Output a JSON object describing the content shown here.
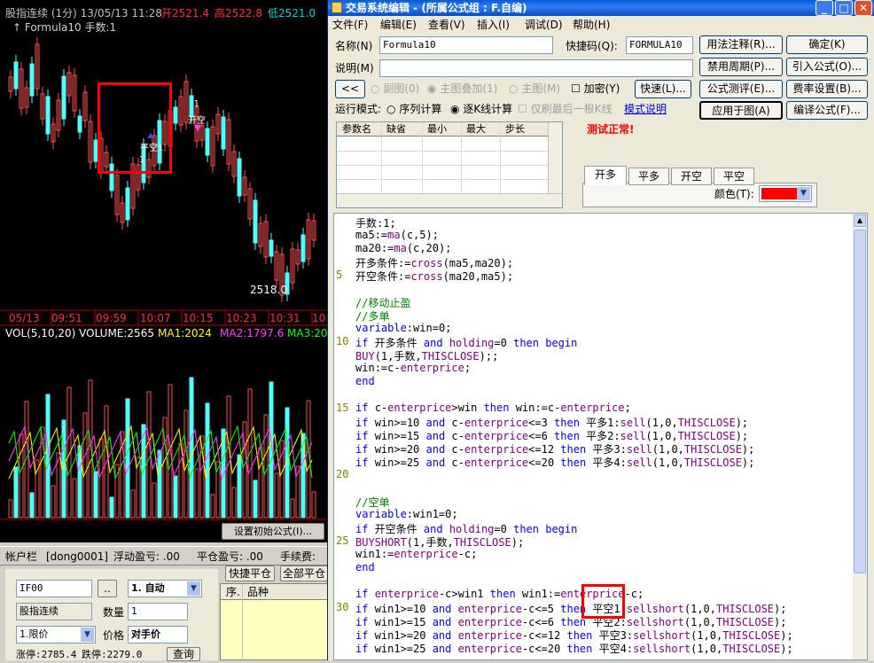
{
  "chart": {
    "header": "股指连续 (1分) 13/05/13 11:28",
    "open": "开2521.4",
    "high": "高2522.8",
    "low": "低2521.0",
    "formula": "↑ Formula10  手数:1",
    "label_close_short": "平空1",
    "label_one": "1",
    "label_neg1": "-1",
    "label_open_short": "开空",
    "low_price": "2518.0",
    "times": [
      "05/13",
      "09:51",
      "09:59",
      "10:07",
      "10:15",
      "10:23",
      "10:31",
      "10:39"
    ],
    "vol_title": "VOL(5,10,20)",
    "vol_value": "VOLUME:2565",
    "ma1": "MA1:2024",
    "ma2": "MA2:1797.6",
    "ma3": "MA3:20",
    "set_initial_btn": "设置初始公式(I)..."
  },
  "trade": {
    "account_label": "帐户栏",
    "account_id": "[dong0001]",
    "float_pl": "浮动盈亏: .00",
    "close_pl": "平仓盈亏: .00",
    "fee": "手续费:",
    "contract_code": "IF00",
    "browse": "..",
    "mode_select": "1. 自动",
    "fast_close": "快捷平仓",
    "close_all": "全部平仓",
    "contract_name": "股指连续",
    "qty_label": "数量",
    "qty_value": "1",
    "price_type": "1.限价",
    "price_label": "价格",
    "price_value": "对手价",
    "limit_up": "涨停:2785.4",
    "limit_down": "跌停:2279.0",
    "query_btn": "查询",
    "col_seq": "序.",
    "col_product": "品种"
  },
  "dialog": {
    "title": "交易系统编辑 - (所属公式组 : F.自编)",
    "menu": [
      "文件(F)",
      "编辑(E)",
      "查看(V)",
      "插入(I)",
      "调试(D)",
      "帮助(H)"
    ],
    "name_label": "名称(N)",
    "name_value": "Formula10",
    "shortcut_label": "快捷码(Q):",
    "shortcut_value": "FORMULA10",
    "desc_label": "说明(M)",
    "btn_usage": "用法注释(R)...",
    "btn_ok": "确定(K)",
    "btn_forbid": "禁用周期(P)...",
    "btn_import": "引入公式(O)...",
    "btn_test": "公式测评(E)...",
    "btn_fee": "费率设置(B)...",
    "btn_apply": "应用于图(A)",
    "btn_compile": "编译公式(F)...",
    "btn_back": "<<",
    "radio_sub": "副图(0)",
    "radio_overlay": "主图叠加(1)",
    "radio_main": "主图(M)",
    "chk_encrypt": "加密(Y)",
    "btn_quick": "快速(L)...",
    "run_mode_label": "运行模式:",
    "radio_seq": "序列计算",
    "radio_kline": "逐K线计算",
    "chk_last": "仅刷最后一根K线",
    "mode_help": "模式说明",
    "param_headers": [
      "参数名",
      "缺省",
      "最小",
      "最大",
      "步长"
    ],
    "status": "测试正常!",
    "tabs": [
      "开多",
      "平多",
      "开空",
      "平空"
    ],
    "color_label": "颜色(T):",
    "color_value": "#ff0000"
  },
  "code_lines": [
    {
      "n": "",
      "t": "手数:1;"
    },
    {
      "n": "",
      "t": "ma5:=ma(c,5);"
    },
    {
      "n": "",
      "t": "ma20:=ma(c,20);"
    },
    {
      "n": "",
      "t": "开多条件:=cross(ma5,ma20);"
    },
    {
      "n": "5",
      "t": "开空条件:=cross(ma20,ma5);"
    },
    {
      "n": "",
      "t": ""
    },
    {
      "n": "",
      "t": "//移动止盈"
    },
    {
      "n": "",
      "t": "//多单"
    },
    {
      "n": "",
      "t": "variable:win=0;"
    },
    {
      "n": "10",
      "t": "if 开多条件 and holding=0 then begin"
    },
    {
      "n": "",
      "t": "BUY(1,手数,THISCLOSE);;"
    },
    {
      "n": "",
      "t": "win:=c-enterprice;"
    },
    {
      "n": "",
      "t": "end"
    },
    {
      "n": "",
      "t": ""
    },
    {
      "n": "15",
      "t": "if c-enterprice>win then win:=c-enterprice;"
    },
    {
      "n": "",
      "t": "if win>=10 and c-enterprice<=3 then 平多1:sell(1,0,THISCLOSE);"
    },
    {
      "n": "",
      "t": "if win>=15 and c-enterprice<=6 then 平多2:sell(1,0,THISCLOSE);"
    },
    {
      "n": "",
      "t": "if win>=20 and c-enterprice<=12 then 平多3:sell(1,0,THISCLOSE);"
    },
    {
      "n": "",
      "t": "if win>=25 and c-enterprice<=20 then 平多4:sell(1,0,THISCLOSE);"
    },
    {
      "n": "20",
      "t": ""
    },
    {
      "n": "",
      "t": ""
    },
    {
      "n": "",
      "t": "//空单"
    },
    {
      "n": "",
      "t": "variable:win1=0;"
    },
    {
      "n": "",
      "t": "if 开空条件 and holding=0 then begin"
    },
    {
      "n": "25",
      "t": "BUYSHORT(1,手数,THISCLOSE);"
    },
    {
      "n": "",
      "t": "win1:=enterprice-c;"
    },
    {
      "n": "",
      "t": "end"
    },
    {
      "n": "",
      "t": ""
    },
    {
      "n": "",
      "t": "if enterprice-c>win1 then win1:=enterprice-c;"
    },
    {
      "n": "30",
      "t": "if win1>=10 and enterprice-c<=5 then 平空1:sellshort(1,0,THISCLOSE);"
    },
    {
      "n": "",
      "t": "if win1>=15 and enterprice-c<=6 then 平空2:sellshort(1,0,THISCLOSE);"
    },
    {
      "n": "",
      "t": "if win1>=20 and enterprice-c<=12 then 平空3:sellshort(1,0,THISCLOSE);"
    },
    {
      "n": "",
      "t": "if win1>=25 and enterprice-c<=20 then 平空4:sellshort(1,0,THISCLOSE);"
    }
  ]
}
